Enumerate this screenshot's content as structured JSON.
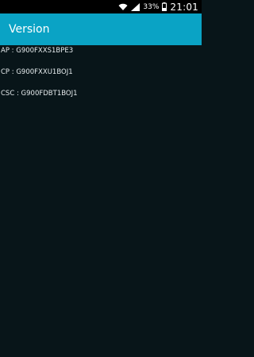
{
  "status_bar": {
    "battery_percent": "33%",
    "time": "21:01",
    "icons": [
      "wifi-icon",
      "signal-icon",
      "battery-icon"
    ]
  },
  "app_bar": {
    "title": "Version"
  },
  "versions": [
    {
      "label": "AP",
      "separator": " : ",
      "value": "G900FXXS1BPE3"
    },
    {
      "label": "CP",
      "separator": " : ",
      "value": "G900FXXU1BOJ1"
    },
    {
      "label": "CSC",
      "separator": " : ",
      "value": "G900FDBT1BOJ1"
    }
  ],
  "colors": {
    "app_bar": "#0aa3c5",
    "background": "#081519",
    "status_bar": "#000000"
  }
}
